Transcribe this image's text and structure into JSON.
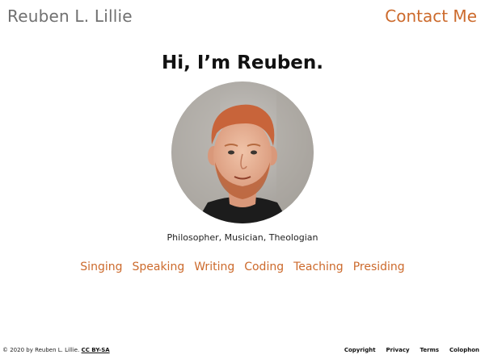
{
  "header": {
    "site_name": "Reuben L. Lillie",
    "contact_label": "Contact Me"
  },
  "hero": {
    "headline": "Hi, I’m Reuben.",
    "portrait_icon": "portrait-photo",
    "tagline": "Philosopher, Musician, Theologian"
  },
  "nav": {
    "items": [
      {
        "label": "Singing"
      },
      {
        "label": "Speaking"
      },
      {
        "label": "Writing"
      },
      {
        "label": "Coding"
      },
      {
        "label": "Teaching"
      },
      {
        "label": "Presiding"
      }
    ]
  },
  "footer": {
    "copyright_text": "© 2020 by Reuben L. Lillie.",
    "license_link": "CC BY-SA",
    "links": [
      {
        "label": "Copyright"
      },
      {
        "label": "Privacy"
      },
      {
        "label": "Terms"
      },
      {
        "label": "Colophon"
      }
    ]
  },
  "colors": {
    "accent": "#cc6a2c",
    "site_name": "#707070",
    "text": "#111111"
  }
}
